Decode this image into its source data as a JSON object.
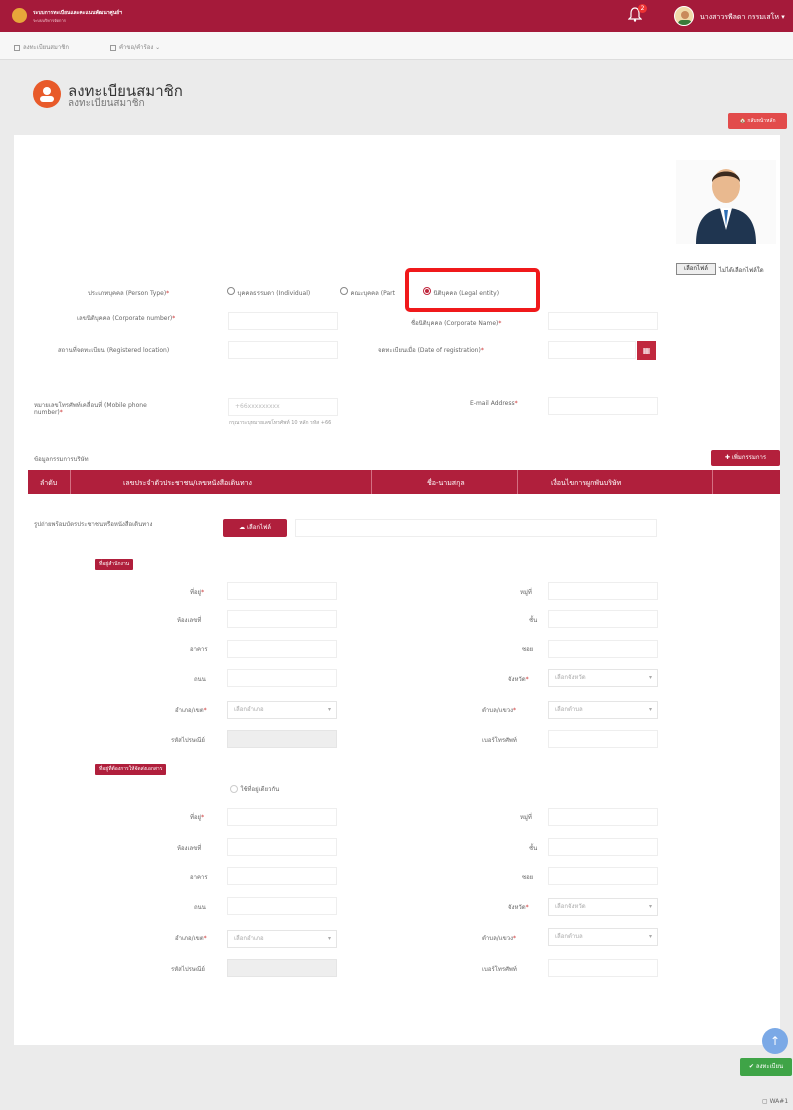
{
  "header": {
    "brand_line1": "ระบบการทะเบียนและคะแนนพัฒนาศูนย์ฯ",
    "brand_line2": "ระบบบริหารจัดการ",
    "notification_count": "2",
    "user_name": "นางสาวรพีลดา กรรมเสโห ▾"
  },
  "subnav": {
    "item1": "ลงทะเบียนสมาชิก",
    "item2": "คำขอ/คำร้อง",
    "item2_chevron": "⌄"
  },
  "page": {
    "title": "ลงทะเบียนสมาชิก",
    "subtitle": "ลงทะเบียนสมาชิก",
    "back_button": "🏠 กลับหน้าหลัก"
  },
  "photo": {
    "file_button": "เลือกไฟล์",
    "file_none": "ไม่ได้เลือกไฟล์ใด"
  },
  "form": {
    "person_type_label": "ประเภทบุคคล (Person Type)",
    "person_type_options": [
      "บุคคลธรรมดา (Individual)",
      "คณะบุคคล (Part",
      "นิติบุคคล (Legal entity)"
    ],
    "corporate_number_label": "เลขนิติบุคคล (Corporate number)",
    "corporate_name_label": "ชื่อนิติบุคคล (Corporate Name)",
    "registered_location_label": "สถานที่จดทะเบียน (Registered location)",
    "date_of_registration_label": "จดทะเบียนเมื่อ (Date of registration)",
    "mobile_label_line1": "หมายเลขโทรศัพท์เคลื่อนที่ (Mobile phone",
    "mobile_label_line2": "number)",
    "mobile_placeholder": "+66xxxxxxxxx",
    "mobile_hint": "กรุณาระบุหมายเลขโทรศัพท์ 10 หลัก รหัส +66",
    "email_label": "E-mail Address",
    "required_mark": "*"
  },
  "directors": {
    "section_label": "ข้อมูลกรรมการบริษัท",
    "add_button": "✚ เพิ่มกรรมการ",
    "columns": [
      "ลำดับ",
      "เลขประจำตัวประชาชน/เลขหนังสือเดินทาง",
      "ชื่อ-นามสกุล",
      "เงื่อนไขการผูกพันบริษัท"
    ]
  },
  "attachment": {
    "label": "รูปถ่ายพร้อมบัตรประชาชนหรือหนังสือเดินทาง",
    "button": "☁ เลือกไฟล์"
  },
  "office_address": {
    "tag": "ที่อยู่สำนักงาน",
    "house_no": "ที่อยู่",
    "moo": "หมู่ที่",
    "room_no": "ห้องเลขที่",
    "floor": "ชั้น",
    "building": "อาคาร",
    "soi": "ซอย",
    "road": "ถนน",
    "province": "จังหวัด",
    "province_placeholder": "เลือกจังหวัด",
    "district": "อำเภอ/เขต",
    "district_placeholder": "เลือกอำเภอ",
    "subdistrict": "ตำบล/แขวง",
    "subdistrict_placeholder": "เลือกตำบล",
    "postcode": "รหัสไปรษณีย์",
    "phone": "เบอร์โทรศัพท์"
  },
  "mailing_address": {
    "tag": "ที่อยู่ที่ต้องการให้จัดส่งเอกสาร",
    "same_as_checkbox": "ใช้ที่อยู่เดียวกัน",
    "house_no": "ที่อยู่",
    "moo": "หมู่ที่",
    "room_no": "ห้องเลขที่",
    "floor": "ชั้น",
    "building": "อาคาร",
    "soi": "ซอย",
    "road": "ถนน",
    "province": "จังหวัด",
    "province_placeholder": "เลือกจังหวัด",
    "district": "อำเภอ/เขต",
    "district_placeholder": "เลือกอำเภอ",
    "subdistrict": "ตำบล/แขวง",
    "subdistrict_placeholder": "เลือกตำบล",
    "postcode": "รหัสไปรษณีย์",
    "phone": "เบอร์โทรศัพท์"
  },
  "actions": {
    "scroll_top": "↑",
    "register_button": "✔ ลงทะเบียน"
  },
  "footer": {
    "text": "▢ WA#1"
  },
  "colors": {
    "primary": "#a51a3a",
    "highlight_box": "#f0191b",
    "success": "#3fa447"
  }
}
